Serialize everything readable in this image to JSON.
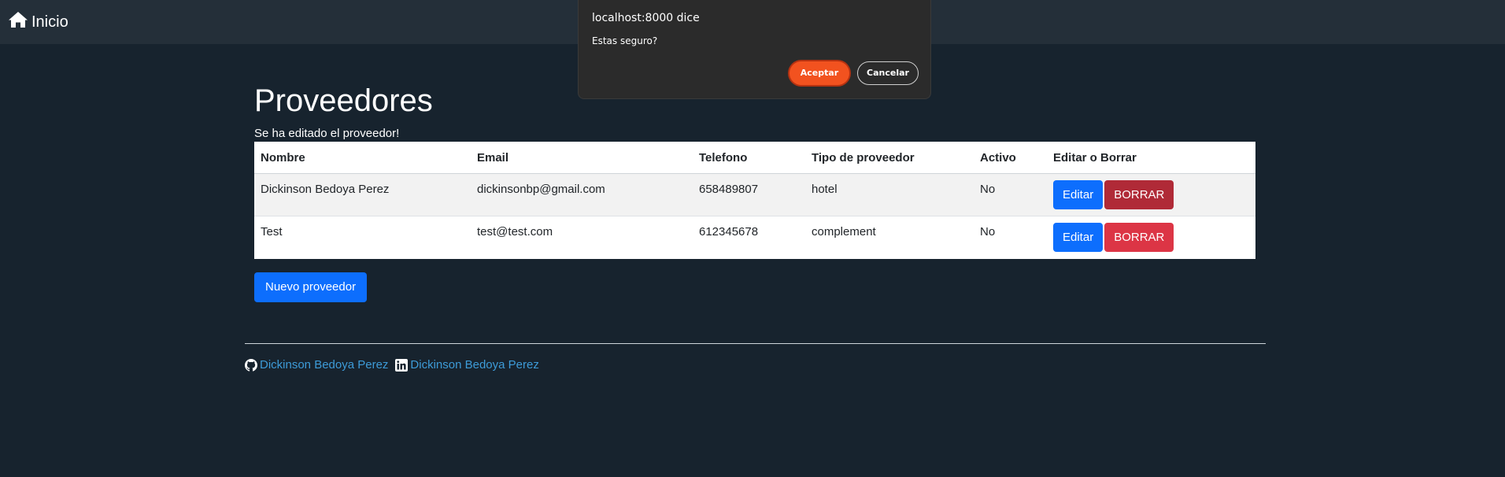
{
  "navbar": {
    "brand_label": "Inicio",
    "brand_icon": "home-icon"
  },
  "page": {
    "title": "Proveedores",
    "flash_message": "Se ha editado el proveedor!"
  },
  "table": {
    "headers": [
      "Nombre",
      "Email",
      "Telefono",
      "Tipo de proveedor",
      "Activo",
      "Editar o Borrar"
    ],
    "rows": [
      {
        "nombre": "Dickinson Bedoya Perez",
        "email": "dickinsonbp@gmail.com",
        "telefono": "658489807",
        "tipo": "hotel",
        "activo": "No",
        "edit_label": "Editar",
        "delete_label": "BORRAR"
      },
      {
        "nombre": "Test",
        "email": "test@test.com",
        "telefono": "612345678",
        "tipo": "complement",
        "activo": "No",
        "edit_label": "Editar",
        "delete_label": "BORRAR"
      }
    ]
  },
  "new_button_label": "Nuevo proveedor",
  "footer": {
    "github_label": "Dickinson Bedoya Perez",
    "github_icon": "github-icon",
    "linkedin_label": "Dickinson Bedoya Perez",
    "linkedin_icon": "linkedin-icon"
  },
  "dialog": {
    "title": "localhost:8000 dice",
    "message": "Estas seguro?",
    "ok_label": "Aceptar",
    "cancel_label": "Cancelar"
  },
  "colors": {
    "background": "#17232e",
    "navbar": "#242f39",
    "primary": "#0d6efd",
    "danger": "#dc3545",
    "link": "#3d9bd8",
    "dialog_accent": "#f2521f"
  }
}
